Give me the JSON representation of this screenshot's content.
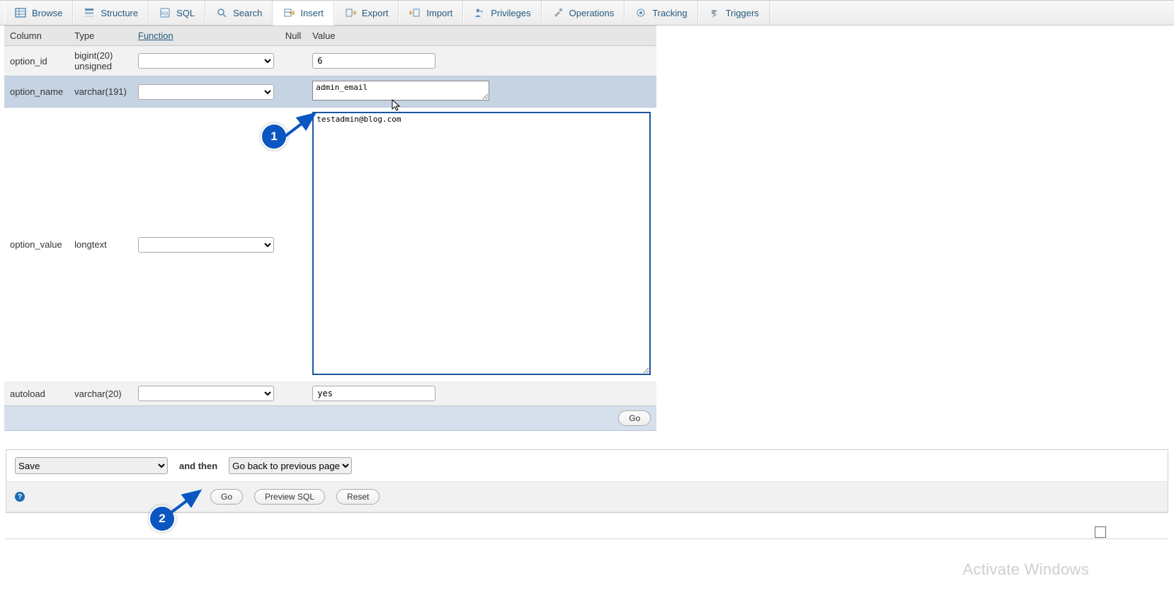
{
  "tabs": [
    {
      "label": "Browse",
      "icon": "table"
    },
    {
      "label": "Structure",
      "icon": "structure"
    },
    {
      "label": "SQL",
      "icon": "sql"
    },
    {
      "label": "Search",
      "icon": "search"
    },
    {
      "label": "Insert",
      "icon": "insert",
      "active": true
    },
    {
      "label": "Export",
      "icon": "export"
    },
    {
      "label": "Import",
      "icon": "import"
    },
    {
      "label": "Privileges",
      "icon": "privileges"
    },
    {
      "label": "Operations",
      "icon": "operations"
    },
    {
      "label": "Tracking",
      "icon": "tracking"
    },
    {
      "label": "Triggers",
      "icon": "triggers"
    }
  ],
  "headers": {
    "column": "Column",
    "type": "Type",
    "function": "Function",
    "null": "Null",
    "value": "Value"
  },
  "rows": [
    {
      "column": "option_id",
      "type": "bigint(20) unsigned",
      "value": "6",
      "kind": "text",
      "row": "sel"
    },
    {
      "column": "option_name",
      "type": "varchar(191)",
      "value": "admin_email",
      "kind": "smalltextarea",
      "row": "hl"
    },
    {
      "column": "option_value",
      "type": "longtext",
      "value": "testadmin@blog.com",
      "kind": "bigtextarea",
      "row": "plain"
    },
    {
      "column": "autoload",
      "type": "varchar(20)",
      "value": "yes",
      "kind": "text",
      "row": "odd"
    }
  ],
  "go_label": "Go",
  "lower": {
    "save_option": "Save",
    "and_then": "and then",
    "after_option": "Go back to previous page",
    "go": "Go",
    "preview": "Preview SQL",
    "reset": "Reset"
  },
  "markers": {
    "one": "1",
    "two": "2"
  },
  "watermark": "Activate Windows"
}
